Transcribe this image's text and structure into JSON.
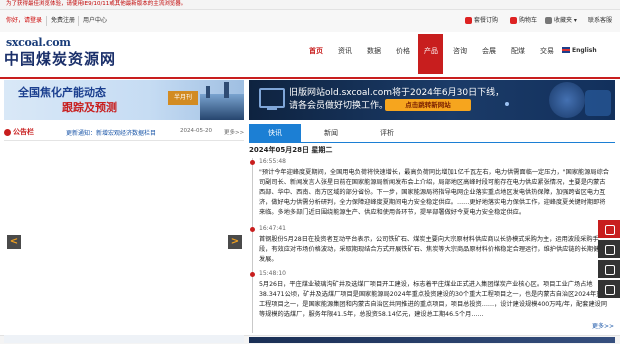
{
  "notice": "为了获得最佳浏览体验，请使用IE9/10/11或其他最新版本的主流浏览器。",
  "topbar": {
    "login": "你好，请登录",
    "register": "免费注册",
    "user_center": "用户中心",
    "subscription": "套餐订购",
    "purchase": "购物车",
    "favorites": "收藏夹",
    "contact": "联系客服"
  },
  "logo": {
    "url": "sxcoal.com",
    "name": "中国煤炭资源网"
  },
  "nav": {
    "home": "首页",
    "news": "资讯",
    "data": "数据",
    "price": "价格",
    "product": "产品",
    "consult": "咨询",
    "conference": "会展",
    "coal_dist": "配煤",
    "trade": "交易",
    "english": "English"
  },
  "banner1": {
    "line1": "全国焦化产能动态",
    "line2": "跟踪及预测",
    "badge": "半月刊"
  },
  "banner2": {
    "line1": "旧版网站old.sxcoal.com将于2024年6月30日下线，",
    "line2": "请各会员做好切换工作。",
    "button": "点击跳转新网站"
  },
  "announcement": {
    "label": "公告栏",
    "title": "更新通知：新增宏观经济数据栏目",
    "date": "2024-05-20",
    "more": "更多>>"
  },
  "tabs": [
    "快讯",
    "新闻",
    "评析"
  ],
  "date_heading": "2024年05月28日 星期二",
  "news": [
    {
      "time": "16:55:48",
      "text": "\"预计今年迎峰度夏期间，全国用电负荷将快速增长，最高负荷同比增加1亿千瓦左右，电力供需面临一定压力，\"国家能源局综合司副司长、新闻发言人张星日前在国家能源局新闻发布会上介绍，局部地区高峰时段可能存在电力供应紧张情况，主要是内蒙古西部、华中、西南、南方区域的部分省份。下一步，国家能源局将指导电网企业落实重点地区发电供热保障，加强跨省区电力互济，做好电力供需分析研判，全力保障迎峰度夏期间电力安全稳定供应。……更好地落实电力保供工作，迎峰度夏关键时期即将来临。多地多部门近日围绕能源生产、供应和使用各环节，提早部署做好今夏电力安全稳定供应。"
    },
    {
      "time": "16:47:41",
      "text": "首钢股份5月28日在投资者互动平台表示，公司铁矿石、煤炭主要向大宗原材料供应商以长协模式采购为主，运用波段采购手段，有效应对市场价格波动，采取期现结合方式开展铁矿石、焦炭等大宗商品原材料价格稳定合理运行，维护供应链的长期健康发展。"
    },
    {
      "time": "15:48:10",
      "text": "5月26日，平庄煤业玻璃沟矿井及选煤厂项目开工建设，标志着平庄煤业正式进入集团煤炭产业核心区。项目工业广场占地38.3471公顷，矿井及选煤厂项目是国家能源局2024年重点投资建设的30个重大工程项目之一，也是内蒙古自治区2024年重大工程项目之一，是国家能源集团和内蒙古自治区共同推进的重点项目，项目总投资……，设计建设规模400万吨/年，配套建设同等规模的选煤厂，服务年限41.5年，总投资58.14亿元，建设总工期46.5个月……"
    }
  ],
  "more": "更多>>"
}
